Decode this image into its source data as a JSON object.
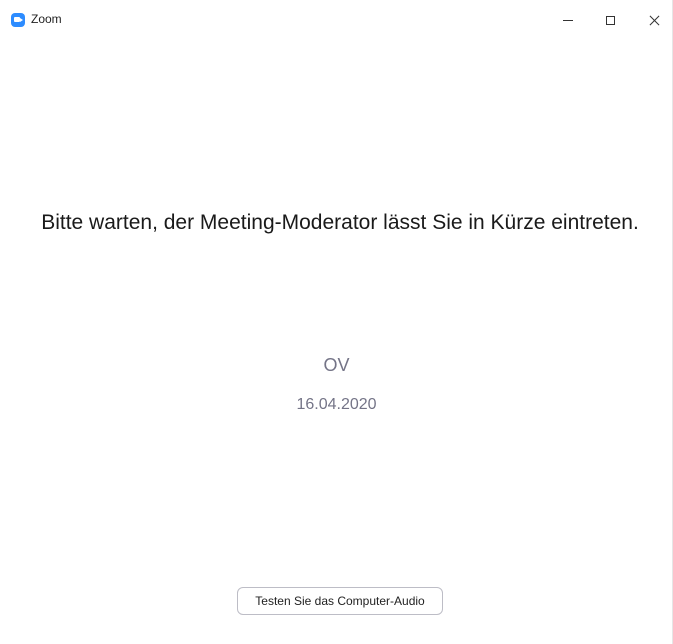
{
  "window": {
    "title": "Zoom",
    "icon": "zoom-camera-icon",
    "controls": {
      "minimize_icon": "minimize-icon",
      "maximize_icon": "maximize-icon",
      "close_icon": "close-icon"
    }
  },
  "waiting_room": {
    "message": "Bitte warten, der Meeting-Moderator lässt Sie in Kürze eintreten.",
    "meeting_name": "OV",
    "meeting_date": "16.04.2020",
    "test_audio_label": "Testen Sie das Computer-Audio"
  },
  "colors": {
    "brand_blue": "#2d8cff",
    "secondary_text": "#747487",
    "primary_text": "#1a1a1a"
  }
}
